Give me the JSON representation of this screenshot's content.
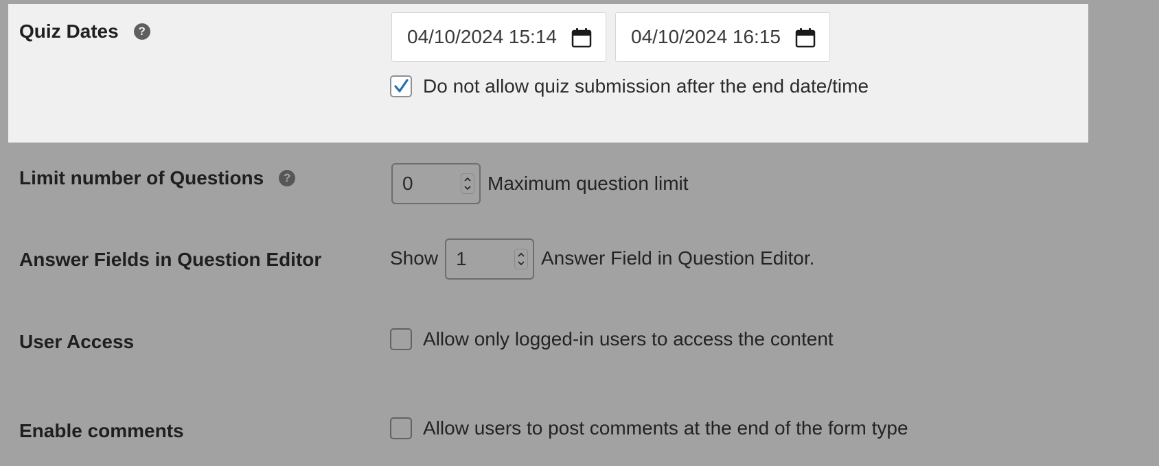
{
  "quiz_dates": {
    "label": "Quiz Dates",
    "start_date": "04/10/2024 15:14",
    "end_date": "04/10/2024 16:15",
    "restrict_checkbox_checked": true,
    "restrict_label": "Do not allow quiz submission after the end date/time"
  },
  "limit_questions": {
    "label": "Limit number of Questions",
    "value": "0",
    "suffix": "Maximum question limit"
  },
  "answer_fields": {
    "label": "Answer Fields in Question Editor",
    "prefix": "Show",
    "value": "1",
    "suffix": "Answer Field in Question Editor."
  },
  "user_access": {
    "label": "User Access",
    "checkbox_checked": false,
    "checkbox_label": "Allow only logged-in users to access the content"
  },
  "comments": {
    "label": "Enable comments",
    "checkbox_checked": false,
    "checkbox_label": "Allow users to post comments at the end of the form type"
  },
  "icons": {
    "help": "?",
    "calendar": "calendar-icon",
    "checkmark": "checkmark-icon",
    "spinner": "spinner-arrows-icon"
  },
  "colors": {
    "overlay": "#a2a2a2",
    "panel": "#f0f0f0",
    "check_blue": "#2271b1"
  }
}
